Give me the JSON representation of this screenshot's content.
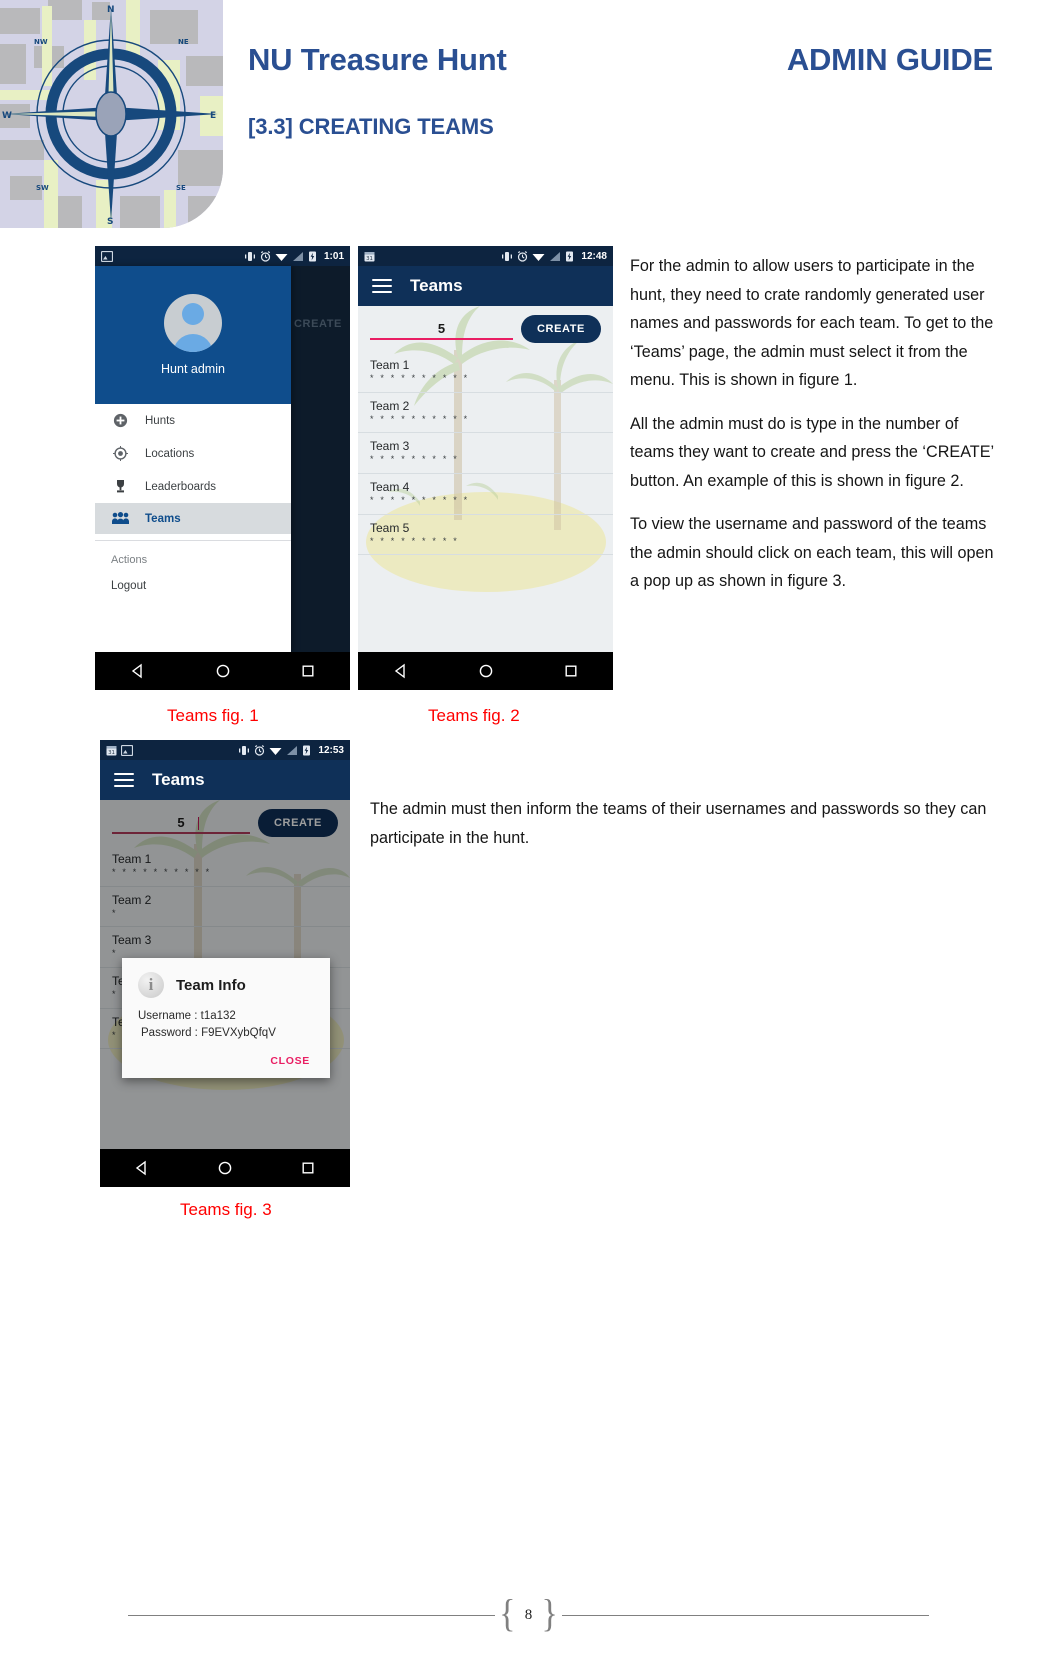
{
  "header": {
    "title": "NU Treasure Hunt",
    "guide_label": "ADMIN GUIDE",
    "section": "[3.3] CREATING TEAMS",
    "logo_icon": "compass-map-icon"
  },
  "figures": {
    "fig1": {
      "caption": "Teams fig. 1",
      "status_bar": {
        "time": "1:01",
        "icons": [
          "image-icon",
          "vibrate-icon",
          "alarm-icon",
          "wifi-icon",
          "signal-icon",
          "battery-icon"
        ]
      },
      "drawer": {
        "user_name": "Hunt admin",
        "avatar_icon": "person-avatar-icon",
        "items": [
          {
            "label": "Hunts",
            "icon": "plus-circle-icon",
            "active": false
          },
          {
            "label": "Locations",
            "icon": "location-target-icon",
            "active": false
          },
          {
            "label": "Leaderboards",
            "icon": "trophy-icon",
            "active": false
          },
          {
            "label": "Teams",
            "icon": "people-group-icon",
            "active": true
          }
        ],
        "actions_label": "Actions",
        "logout_label": "Logout"
      },
      "behind_create_label": "CREATE",
      "navbar": [
        "back-triangle-icon",
        "home-circle-icon",
        "recents-square-icon"
      ]
    },
    "fig2": {
      "caption": "Teams fig. 2",
      "status_bar": {
        "time": "12:48",
        "icons": [
          "calendar-icon",
          "vibrate-icon",
          "alarm-icon",
          "wifi-icon",
          "signal-icon",
          "battery-icon"
        ]
      },
      "appbar": {
        "title": "Teams",
        "menu_icon": "hamburger-menu-icon"
      },
      "count_value": "5",
      "create_label": "CREATE",
      "teams": [
        {
          "name": "Team 1",
          "password_mask": "* * * * * * * * * *"
        },
        {
          "name": "Team 2",
          "password_mask": "* * * * * * * * * *"
        },
        {
          "name": "Team 3",
          "password_mask": "* * * * * * * * *"
        },
        {
          "name": "Team 4",
          "password_mask": "* * * * * * * * * *"
        },
        {
          "name": "Team 5",
          "password_mask": "* * * * * * * * *"
        }
      ],
      "navbar": [
        "back-triangle-icon",
        "home-circle-icon",
        "recents-square-icon"
      ]
    },
    "fig3": {
      "caption": "Teams fig. 3",
      "status_bar": {
        "time": "12:53",
        "icons": [
          "calendar-icon",
          "image-icon",
          "vibrate-icon",
          "alarm-icon",
          "wifi-icon",
          "signal-icon",
          "battery-icon"
        ]
      },
      "appbar": {
        "title": "Teams",
        "menu_icon": "hamburger-menu-icon"
      },
      "count_value": "5",
      "create_label": "CREATE",
      "teams": [
        {
          "name": "Team 1",
          "password_mask": "* * * * * * * * * *"
        },
        {
          "name": "Team 2",
          "password_mask": "*"
        },
        {
          "name": "Team 3",
          "password_mask": "*"
        },
        {
          "name": "Team 4",
          "password_mask": "*"
        },
        {
          "name": "Team 5",
          "password_mask": "* * * * * * * * *"
        }
      ],
      "dialog": {
        "title": "Team Info",
        "icon": "info-circle-icon",
        "username_line": "Username : t1a132",
        "password_line": "Password : F9EVXybQfqV",
        "close_label": "CLOSE"
      },
      "navbar": [
        "back-triangle-icon",
        "home-circle-icon",
        "recents-square-icon"
      ]
    }
  },
  "body": {
    "p1": "For the admin to allow users to participate in the hunt, they need to crate randomly generated user names and passwords for each team. To get to the ‘Teams’ page, the admin must select it from the menu. This is shown in figure 1.",
    "p2": "All the admin must do is type in the number of teams they want to create and press the ‘CREATE’ button. An example of this is shown in figure 2.",
    "p3": "To view the username and password of the teams the admin should click on each team, this will open a pop up as shown in figure 3.",
    "p4": "The admin must then inform the teams of their usernames and passwords so they can participate in the hunt."
  },
  "footer": {
    "page_number": "8",
    "brace_left": "{",
    "brace_right": "}"
  },
  "colors": {
    "brand_blue": "#2a4f92",
    "app_bar": "#0f3058",
    "status_bar": "#0d2440",
    "drawer_header": "#0f4d8c",
    "caption_red": "#ff0000",
    "accent_pink": "#e91e63"
  }
}
